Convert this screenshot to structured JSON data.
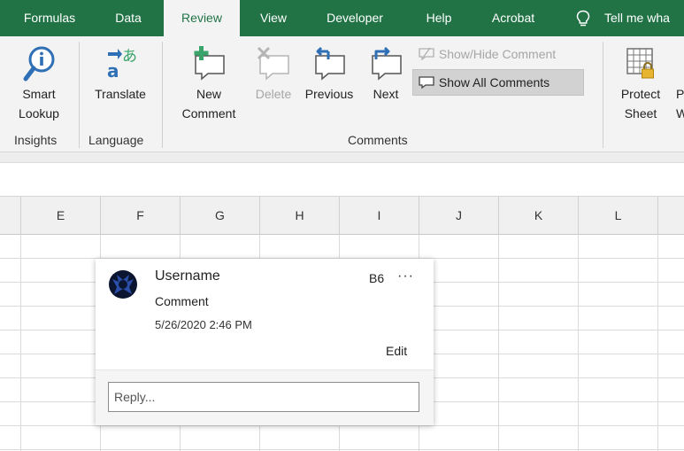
{
  "tabs": [
    {
      "label": "Formulas",
      "active": false
    },
    {
      "label": "Data",
      "active": false
    },
    {
      "label": "Review",
      "active": true
    },
    {
      "label": "View",
      "active": false
    },
    {
      "label": "Developer",
      "active": false
    },
    {
      "label": "Help",
      "active": false
    },
    {
      "label": "Acrobat",
      "active": false
    }
  ],
  "tell_me": "Tell me wha",
  "ribbon": {
    "insights": {
      "smart_lookup_line1": "Smart",
      "smart_lookup_line2": "Lookup",
      "group": "Insights"
    },
    "language": {
      "translate": "Translate",
      "group": "Language"
    },
    "comments": {
      "new_line1": "New",
      "new_line2": "Comment",
      "delete": "Delete",
      "previous": "Previous",
      "next": "Next",
      "show_hide": "Show/Hide Comment",
      "show_all": "Show All Comments",
      "group": "Comments"
    },
    "protect": {
      "protect_line1": "Protect",
      "protect_line2": "Sheet",
      "partial_line1": "P",
      "partial_line2": "W"
    }
  },
  "columns": [
    "E",
    "F",
    "G",
    "H",
    "I",
    "J",
    "K",
    "L"
  ],
  "comment": {
    "author": "Username",
    "cell": "B6",
    "more": "···",
    "text": "Comment",
    "date": "5/26/2020 2:46 PM",
    "edit": "Edit",
    "reply_placeholder": "Reply..."
  },
  "colors": {
    "brand_green": "#217346",
    "ribbon_bg": "#f3f3f3",
    "icon_blue": "#2f6fb5",
    "icon_green": "#3aa46a"
  }
}
